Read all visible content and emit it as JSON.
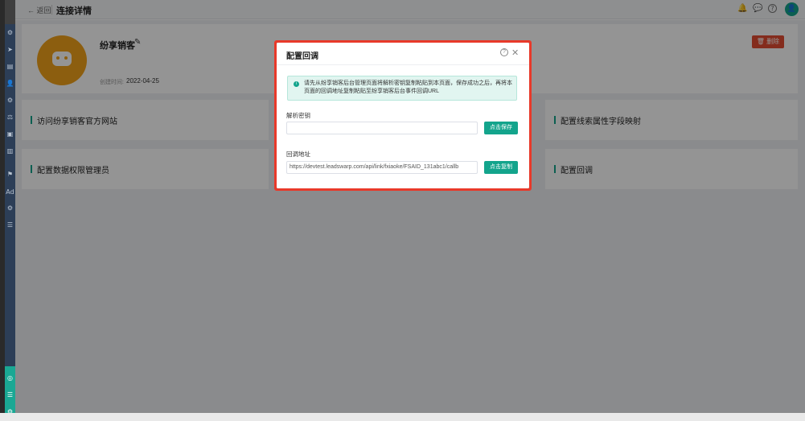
{
  "topbar": {
    "back_label": "← 返回",
    "title": "连接详情",
    "bell_icon": "🔔",
    "message_icon": "💬",
    "help_icon": "?",
    "avatar_icon": "👤"
  },
  "sidebar": {
    "icons": [
      "⚙",
      "➤",
      "▤",
      "👤",
      "⚙",
      "⚖",
      "▣",
      "▥",
      "⚑",
      "Ad",
      "⚙",
      "☰"
    ],
    "bottom_icons": [
      "◎",
      "☰",
      "⚙"
    ]
  },
  "profile": {
    "name": "纷享销客",
    "edit_icon": "✎",
    "created_label": "创建时间:",
    "created_value": "2022-04-25",
    "delete_label": "🗑 删除"
  },
  "actions": {
    "visit_site": "访问纷享销客官方网站",
    "field_mapping": "配置线索属性字段映射",
    "data_permission": "配置数据权限管理员",
    "callback": "配置回调"
  },
  "modal": {
    "title": "配置回调",
    "help_symbol": "?",
    "close_symbol": "✕",
    "notice_icon": "i",
    "notice_text": "请先从纷享销客后台管理页面将解析密钥复制粘贴到本页面，保存成功之后，再将本页面的回调地址复制粘贴至纷享销客后台事件回调URL",
    "secret_label": "解析密钥",
    "secret_value": "",
    "save_button": "点击保存",
    "callback_label": "回调地址",
    "callback_value": "https://devtest.leadswarp.com/api/link/fxiaoke/FSAID_131abc1/callb",
    "copy_button": "点击复制"
  },
  "colors": {
    "accent": "#13a48c",
    "danger": "#e34d32",
    "highlight": "#e8392a",
    "logo": "#f2a21b"
  }
}
